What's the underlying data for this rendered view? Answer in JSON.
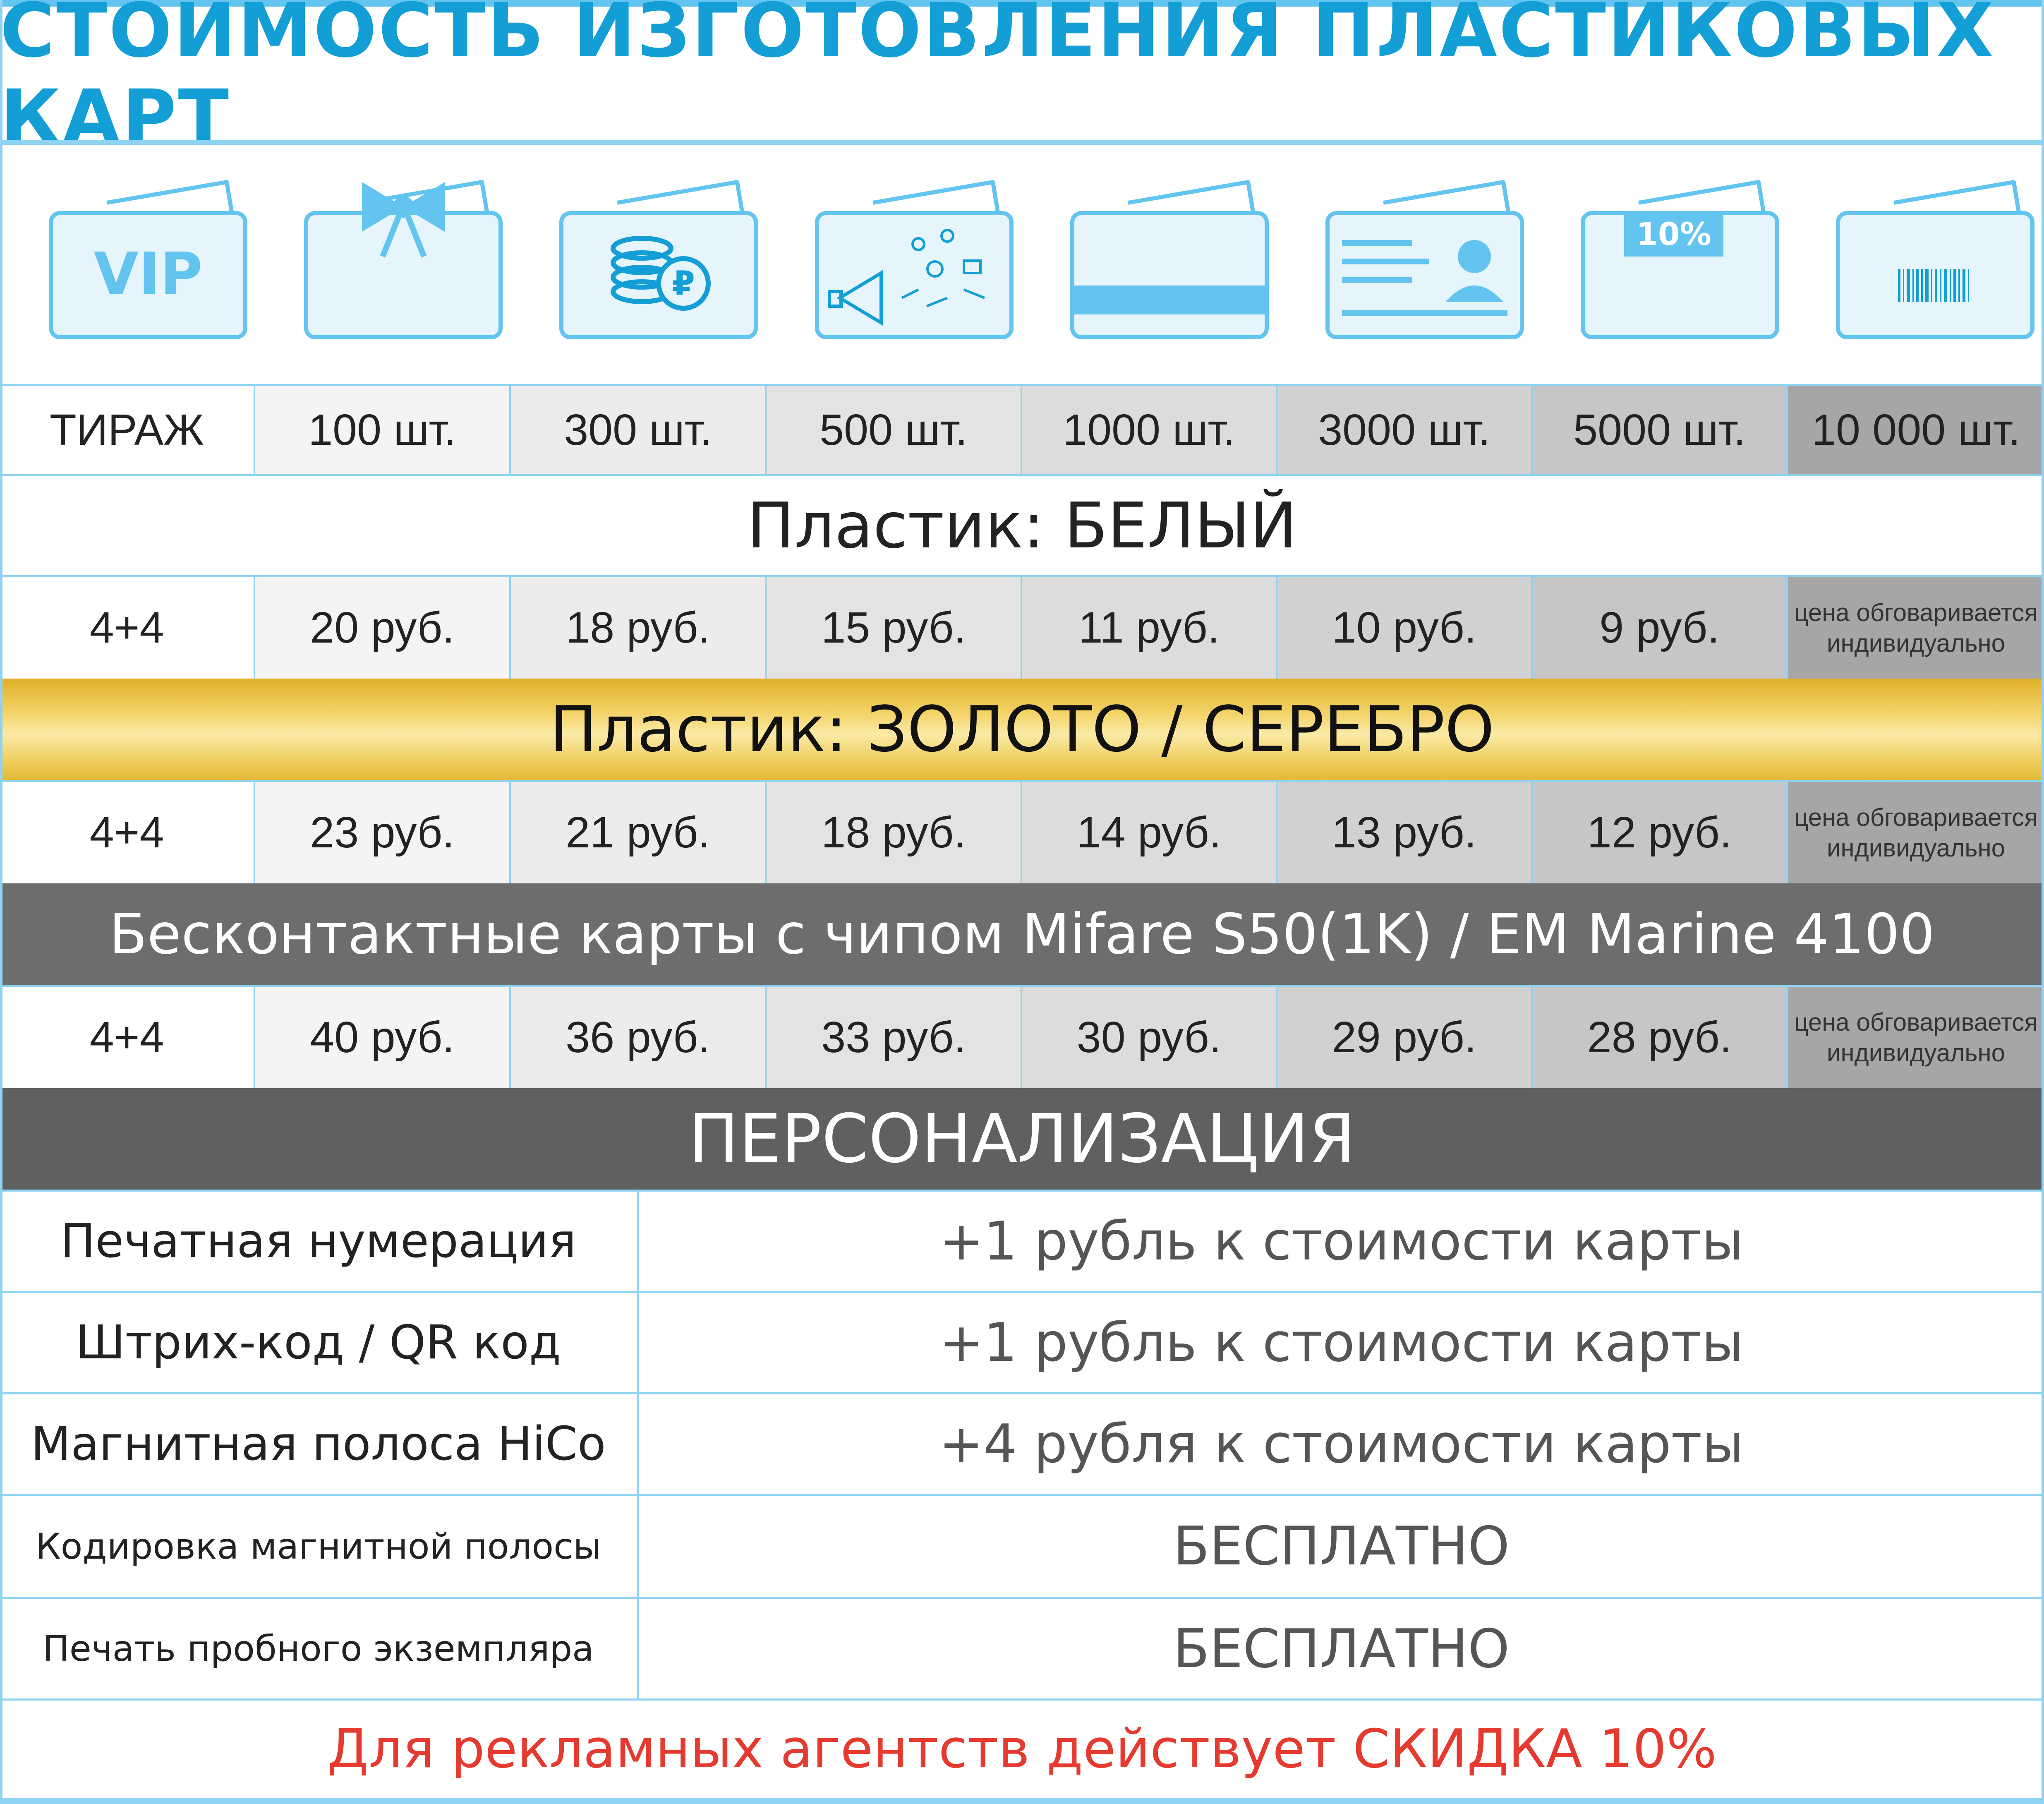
{
  "title": "СТОИМОСТЬ ИЗГОТОВЛЕНИЯ ПЛАСТИКОВЫХ КАРТ",
  "icons": [
    {
      "name": "vip-card-icon",
      "text": "VIP"
    },
    {
      "name": "gift-bow-card-icon",
      "text": ""
    },
    {
      "name": "coins-ruble-card-icon",
      "text": ""
    },
    {
      "name": "marketing-megaphone-card-icon",
      "text": ""
    },
    {
      "name": "magnetic-stripe-card-icon",
      "text": ""
    },
    {
      "name": "id-badge-card-icon",
      "text": ""
    },
    {
      "name": "discount-card-icon",
      "text": "10%"
    },
    {
      "name": "barcode-card-icon",
      "text": ""
    }
  ],
  "header": {
    "label": "ТИРАЖ",
    "quantities": [
      "100 шт.",
      "300 шт.",
      "500 шт.",
      "1000 шт.",
      "3000 шт.",
      "5000 шт.",
      "10 000 шт."
    ]
  },
  "sections": {
    "white": {
      "title": "Пластик: БЕЛЫЙ",
      "row_label": "4+4",
      "prices": [
        "20 руб.",
        "18 руб.",
        "15 руб.",
        "11 руб.",
        "10 руб.",
        "9 руб."
      ],
      "note": "цена обговаривается индивидуально"
    },
    "gold": {
      "title": "Пластик: ЗОЛОТО / СЕРЕБРО",
      "row_label": "4+4",
      "prices": [
        "23 руб.",
        "21 руб.",
        "18 руб.",
        "14 руб.",
        "13 руб.",
        "12 руб."
      ],
      "note": "цена обговаривается индивидуально"
    },
    "contactless": {
      "title": "Бесконтактные карты с чипом  Mifare S50(1K)  /  EM Marine 4100",
      "row_label": "4+4",
      "prices": [
        "40 руб.",
        "36 руб.",
        "33 руб.",
        "30 руб.",
        "29 руб.",
        "28 руб."
      ],
      "note": "цена обговаривается индивидуально"
    }
  },
  "personalization": {
    "title": "ПЕРСОНАЛИЗАЦИЯ",
    "rows": [
      {
        "label": "Печатная нумерация",
        "value": "+1 рубль к стоимости карты"
      },
      {
        "label": "Штрих-код / QR код",
        "value": "+1 рубль к стоимости карты"
      },
      {
        "label": "Магнитная полоса HiCo",
        "value": "+4 рубля к стоимости карты"
      },
      {
        "label": "Кодировка магнитной полосы",
        "value": "БЕСПЛАТНО"
      },
      {
        "label": "Печать пробного экземпляра",
        "value": "БЕСПЛАТНО"
      }
    ]
  },
  "footer": "Для рекламных агентств действует СКИДКА 10%",
  "colors": {
    "accent_blue": "#139ed6",
    "line_blue": "#8fd3f2",
    "icon_blue": "#63c5ef",
    "footer_red": "#e53a2f",
    "section_grey": "#6d6d6d"
  }
}
